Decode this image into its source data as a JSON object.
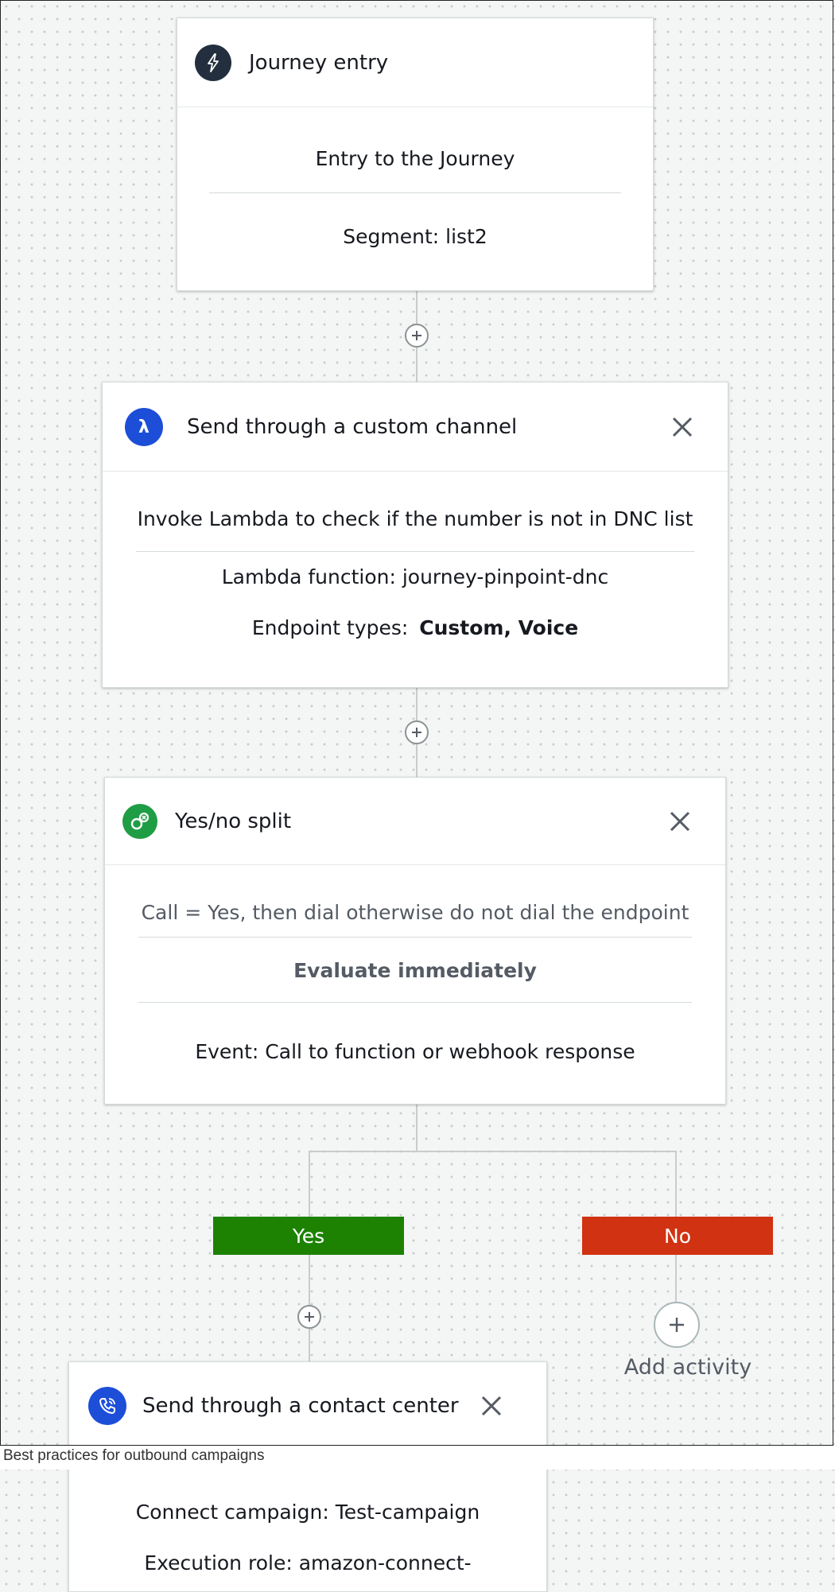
{
  "journey_entry": {
    "title": "Journey entry",
    "description": "Entry to the Journey",
    "segment": "Segment: list2"
  },
  "custom_channel": {
    "title": "Send through a custom channel",
    "description": "Invoke Lambda to check if the number is not in DNC list",
    "lambda_function": "Lambda function: journey-pinpoint-dnc",
    "endpoint_types_label": "Endpoint types:",
    "endpoint_types_value": "Custom, Voice"
  },
  "yes_no_split": {
    "title": "Yes/no split",
    "condition": "Call = Yes, then dial otherwise do not dial the endpoint",
    "evaluation": "Evaluate immediately",
    "event": "Event:  Call to function or webhook response"
  },
  "branches": {
    "yes_label": "Yes",
    "no_label": "No",
    "yes_color": "#1d8102",
    "no_color": "#d13212"
  },
  "add_activity": {
    "label": "Add activity"
  },
  "contact_center": {
    "title": "Send through a contact center",
    "campaign": "Connect campaign: Test-campaign",
    "execution_role": "Execution role: amazon-connect-"
  },
  "footer": {
    "caption": "Best practices for outbound campaigns"
  },
  "icons": {
    "journey_entry": "lightning-icon",
    "custom_channel": "lambda-icon",
    "split": "split-icon",
    "contact_center": "phone-icon",
    "close": "close-icon",
    "add": "plus-icon"
  }
}
